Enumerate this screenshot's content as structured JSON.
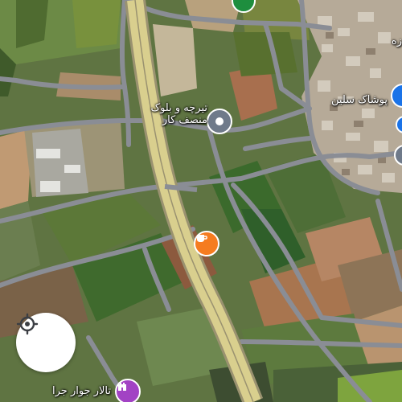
{
  "map": {
    "labels": {
      "poi_tiroche": "تیرچه و بلوک\nمنصف کار",
      "poi_clothing": "پوشاک سلین",
      "poi_hall": "تالار جوار جرا",
      "poi_top_right": "زه"
    },
    "icons": {
      "tiroche_pin": "location-pin-icon",
      "cafe_pin": "coffee-cup-icon",
      "hall_pin": "castle-icon",
      "clothing_pin": "shopping-bag-icon",
      "top_pin": "green-place-icon",
      "right_pins": "blue-place-icon",
      "locate": "crosshair-icon"
    },
    "colors": {
      "road": "#8a8d95",
      "highway": "#d9cf8e",
      "cafe_pin": "#f57c20",
      "hall_pin": "#a243c4",
      "place_pin": "#6f7a8a",
      "blue_pin": "#1a73e8",
      "green_pin": "#1e8e3e"
    }
  },
  "controls": {
    "locate_button": "my-location"
  }
}
